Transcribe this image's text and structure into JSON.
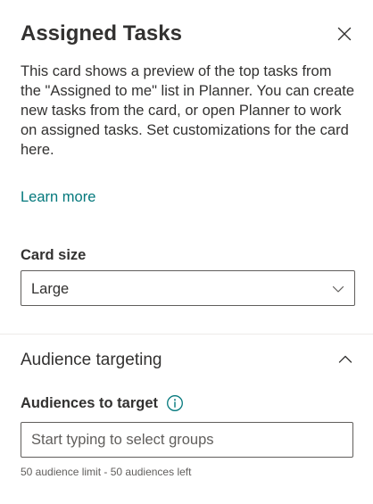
{
  "panel": {
    "title": "Assigned Tasks",
    "close_icon": "close-icon",
    "description": "This card shows a preview of the top tasks from the \"Assigned to me\" list in Planner. You can create new tasks from the card, or open Planner to work on assigned tasks. Set customizations for the card here.",
    "learn_more": "Learn more"
  },
  "card_size": {
    "label": "Card size",
    "selected": "Large",
    "chevron_icon": "chevron-down-icon"
  },
  "audience": {
    "section_title": "Audience targeting",
    "section_expanded": true,
    "chevron_icon": "chevron-up-icon",
    "field_label": "Audiences to target",
    "info_icon": "info-icon",
    "input_value": "",
    "placeholder": "Start typing to select groups",
    "helper": "50 audience limit - 50 audiences left"
  },
  "colors": {
    "text": "#323130",
    "link": "#03787c",
    "border": "#605e5c",
    "divider": "#edebe9",
    "secondary_text": "#605e5c",
    "background": "#ffffff"
  }
}
